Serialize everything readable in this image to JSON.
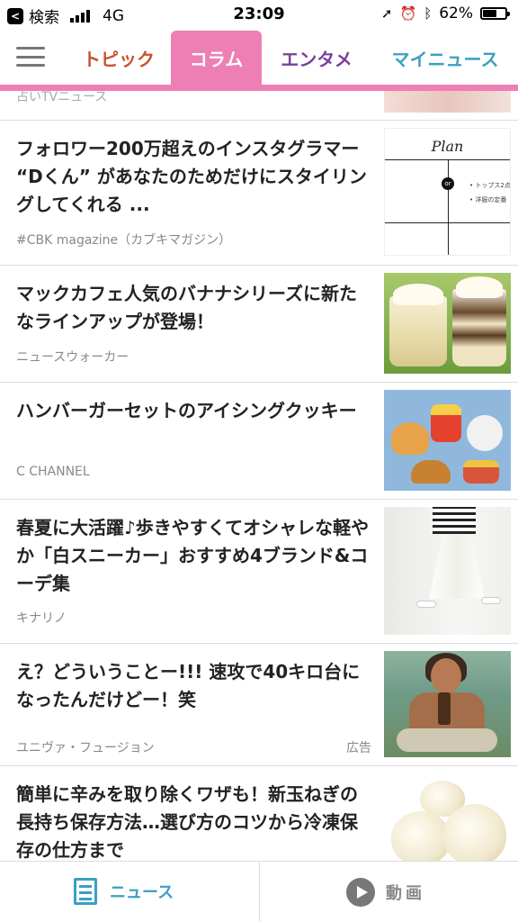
{
  "status_bar": {
    "back_app": "検索",
    "network": "4G",
    "time": "23:09",
    "battery": "62%",
    "battery_level": 0.62
  },
  "tabs": [
    {
      "label": "トピック",
      "color": "#c5542c"
    },
    {
      "label": "コラム",
      "color": "#ee7fb4",
      "active": true
    },
    {
      "label": "エンタメ",
      "color": "#7a3f9a"
    },
    {
      "label": "マイニュース",
      "color": "#3a9fc1"
    }
  ],
  "partial_item": {
    "source": "占いTVニュース"
  },
  "items": [
    {
      "title": "フォロワー200万超えのインスタグラマー “Dくん” があなたのためだけにスタイリングしてくれる ...",
      "source": "#CBK magazine（カブキマガジン）",
      "thumb": {
        "word": "Plan",
        "badge": "or",
        "bullet1": "• トップス2点",
        "bullet2": "• 洋服の定番"
      }
    },
    {
      "title": "マックカフェ人気のバナナシリーズに新たなラインアップが登場！",
      "source": "ニュースウォーカー"
    },
    {
      "title": "ハンバーガーセットのアイシングクッキー",
      "source": "C CHANNEL"
    },
    {
      "title": "春夏に大活躍♪歩きやすくてオシャレな軽やか「白スニーカー」おすすめ4ブランド&コーデ集",
      "source": "キナリノ"
    },
    {
      "title": "え？どういうことー!!! 速攻で40キロ台になったんだけどー！笑",
      "source": "ユニヴァ・フュージョン",
      "ad_label": "広告"
    },
    {
      "title": "簡単に辛みを取り除くワザも！新玉ねぎの長持ち保存方法…選び方のコツから冷凍保存の仕方まで",
      "source": ""
    }
  ],
  "bottom_nav": {
    "news_label": "ニュース",
    "video_label": "動画",
    "active_color": "#3a9fc1"
  }
}
